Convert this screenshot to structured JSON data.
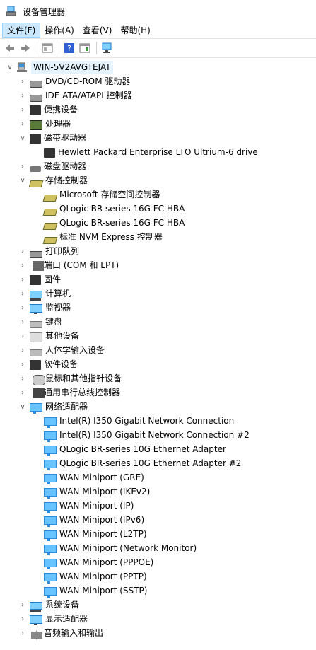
{
  "window": {
    "title": "设备管理器",
    "icon": "device-manager-icon"
  },
  "menu": [
    "文件(F)",
    "操作(A)",
    "查看(V)",
    "帮助(H)"
  ],
  "toolbar": [
    "back-arrow-icon",
    "forward-arrow-icon",
    "properties-icon",
    "help-icon",
    "update-driver-icon",
    "scan-hardware-icon"
  ],
  "tree": {
    "root": {
      "label": "WIN-5V2AVGTEJAT",
      "icon": "computer-icon",
      "expanded": true
    },
    "nodes": [
      {
        "label": "DVD/CD-ROM 驱动器",
        "icon": "disc-icon",
        "level": 1,
        "expanded": false
      },
      {
        "label": "IDE ATA/ATAPI 控制器",
        "icon": "ide-controller-icon",
        "level": 1,
        "expanded": false
      },
      {
        "label": "便携设备",
        "icon": "portable-device-icon",
        "level": 1,
        "expanded": false
      },
      {
        "label": "处理器",
        "icon": "processor-icon",
        "level": 1,
        "expanded": false
      },
      {
        "label": "磁带驱动器",
        "icon": "tape-drive-icon",
        "level": 1,
        "expanded": true
      },
      {
        "label": "Hewlett Packard Enterprise LTO Ultrium-6 drive",
        "icon": "tape-drive-icon",
        "level": 2
      },
      {
        "label": "磁盘驱动器",
        "icon": "disk-drive-icon",
        "level": 1,
        "expanded": false
      },
      {
        "label": "存储控制器",
        "icon": "storage-controller-icon",
        "level": 1,
        "expanded": true
      },
      {
        "label": "Microsoft 存储空间控制器",
        "icon": "storage-controller-icon",
        "level": 2
      },
      {
        "label": "QLogic BR-series 16G FC HBA",
        "icon": "storage-controller-icon",
        "level": 2
      },
      {
        "label": "QLogic BR-series 16G FC HBA",
        "icon": "storage-controller-icon",
        "level": 2
      },
      {
        "label": "标准 NVM Express 控制器",
        "icon": "storage-controller-icon",
        "level": 2
      },
      {
        "label": "打印队列",
        "icon": "printer-icon",
        "level": 1,
        "expanded": false
      },
      {
        "label": "端口 (COM 和 LPT)",
        "icon": "port-icon",
        "level": 1,
        "expanded": false
      },
      {
        "label": "固件",
        "icon": "firmware-icon",
        "level": 1,
        "expanded": false
      },
      {
        "label": "计算机",
        "icon": "computer-icon",
        "level": 1,
        "expanded": false
      },
      {
        "label": "监视器",
        "icon": "monitor-icon",
        "level": 1,
        "expanded": false
      },
      {
        "label": "键盘",
        "icon": "keyboard-icon",
        "level": 1,
        "expanded": false
      },
      {
        "label": "其他设备",
        "icon": "unknown-device-icon",
        "level": 1,
        "expanded": false
      },
      {
        "label": "人体学输入设备",
        "icon": "hid-icon",
        "level": 1,
        "expanded": false
      },
      {
        "label": "软件设备",
        "icon": "software-device-icon",
        "level": 1,
        "expanded": false
      },
      {
        "label": "鼠标和其他指针设备",
        "icon": "mouse-icon",
        "level": 1,
        "expanded": false
      },
      {
        "label": "通用串行总线控制器",
        "icon": "usb-icon",
        "level": 1,
        "expanded": false
      },
      {
        "label": "网络适配器",
        "icon": "network-adapter-icon",
        "level": 1,
        "expanded": true
      },
      {
        "label": "Intel(R) I350 Gigabit Network Connection",
        "icon": "network-adapter-icon",
        "level": 2
      },
      {
        "label": "Intel(R) I350 Gigabit Network Connection #2",
        "icon": "network-adapter-icon",
        "level": 2
      },
      {
        "label": "QLogic BR-series 10G Ethernet Adapter",
        "icon": "network-adapter-icon",
        "level": 2
      },
      {
        "label": "QLogic BR-series 10G Ethernet Adapter #2",
        "icon": "network-adapter-icon",
        "level": 2
      },
      {
        "label": "WAN Miniport (GRE)",
        "icon": "network-adapter-icon",
        "level": 2
      },
      {
        "label": "WAN Miniport (IKEv2)",
        "icon": "network-adapter-icon",
        "level": 2
      },
      {
        "label": "WAN Miniport (IP)",
        "icon": "network-adapter-icon",
        "level": 2
      },
      {
        "label": "WAN Miniport (IPv6)",
        "icon": "network-adapter-icon",
        "level": 2
      },
      {
        "label": "WAN Miniport (L2TP)",
        "icon": "network-adapter-icon",
        "level": 2
      },
      {
        "label": "WAN Miniport (Network Monitor)",
        "icon": "network-adapter-icon",
        "level": 2
      },
      {
        "label": "WAN Miniport (PPPOE)",
        "icon": "network-adapter-icon",
        "level": 2
      },
      {
        "label": "WAN Miniport (PPTP)",
        "icon": "network-adapter-icon",
        "level": 2
      },
      {
        "label": "WAN Miniport (SSTP)",
        "icon": "network-adapter-icon",
        "level": 2
      },
      {
        "label": "系统设备",
        "icon": "system-device-icon",
        "level": 1,
        "expanded": false
      },
      {
        "label": "显示适配器",
        "icon": "display-adapter-icon",
        "level": 1,
        "expanded": false
      },
      {
        "label": "音频输入和输出",
        "icon": "speaker-icon",
        "level": 1,
        "expanded": false
      }
    ]
  }
}
